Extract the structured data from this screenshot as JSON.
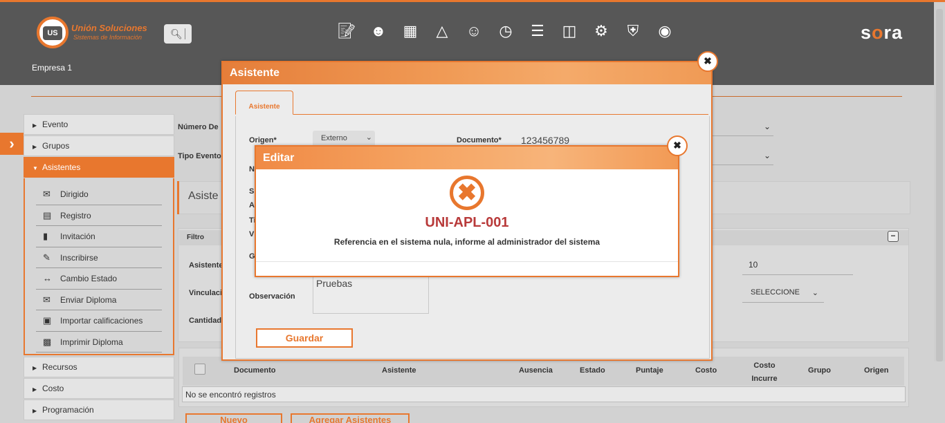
{
  "header": {
    "logo": {
      "title": "Unión Soluciones",
      "subtitle": "Sistemas de Información",
      "mark": "US"
    },
    "search_icon": "search-icon",
    "nav_icons": [
      "edit-document-icon",
      "user-settings-icon",
      "gift-icon",
      "group-icon",
      "user-tag-icon",
      "timer-icon",
      "list-document-icon",
      "presentation-icon",
      "gears-icon",
      "shield-cart-icon",
      "search-users-icon"
    ],
    "brand": {
      "left": "s",
      "accent": "o",
      "right": "ra"
    },
    "company": "Empresa 1"
  },
  "sidebar": {
    "items": [
      {
        "label": "Evento"
      },
      {
        "label": "Grupos"
      },
      {
        "label": "Asistentes"
      },
      {
        "label": "Recursos"
      },
      {
        "label": "Costo"
      },
      {
        "label": "Programación"
      }
    ],
    "subitems": [
      {
        "label": "Dirigido",
        "icon": "mail-send-icon"
      },
      {
        "label": "Registro",
        "icon": "form-icon"
      },
      {
        "label": "Invitación",
        "icon": "file-icon"
      },
      {
        "label": "Inscribirse",
        "icon": "pen-icon"
      },
      {
        "label": "Cambio Estado",
        "icon": "arrows-icon"
      },
      {
        "label": "Enviar Diploma",
        "icon": "envelope-icon"
      },
      {
        "label": "Importar calificaciones",
        "icon": "import-icon"
      },
      {
        "label": "Imprimir Diploma",
        "icon": "print-icon"
      }
    ]
  },
  "background": {
    "numero_label": "Número De",
    "tipo_label": "Tipo Evento",
    "section_title": "Asiste",
    "filter_label": "Filtro",
    "asistente_label": "Asistente",
    "vinculacion_label": "Vinculaci",
    "cantidad_label": "Cantidad",
    "value_10": "10",
    "seleccione": "SELECCIONE",
    "table_headers": [
      "Documento",
      "Asistente",
      "Ausencia",
      "Estado",
      "Puntaje",
      "Costo",
      "Costo Incurre",
      "Grupo",
      "Origen"
    ],
    "no_records": "No se encontró registros",
    "btn_nuevo": "Nuevo",
    "btn_agregar": "Agregar Asistentes"
  },
  "modal_asistente": {
    "title": "Asistente",
    "tab": "Asistente",
    "origen_label": "Origen*",
    "origen_value": "Externo",
    "documento_label": "Documento*",
    "documento_value": "123456789",
    "partial_labels": [
      "N",
      "S",
      "A",
      "Ti",
      "V",
      "G"
    ],
    "observacion_label": "Observación",
    "observacion_value": "Pruebas",
    "guardar": "Guardar"
  },
  "modal_editar": {
    "title": "Editar",
    "error_icon": "error-x-icon",
    "error_code": "UNI-APL-001",
    "error_message": "Referencia en el sistema nula, informe al administrador del sistema"
  },
  "colors": {
    "accent": "#e8772e",
    "header": "#575757",
    "error": "#b83a3a"
  }
}
